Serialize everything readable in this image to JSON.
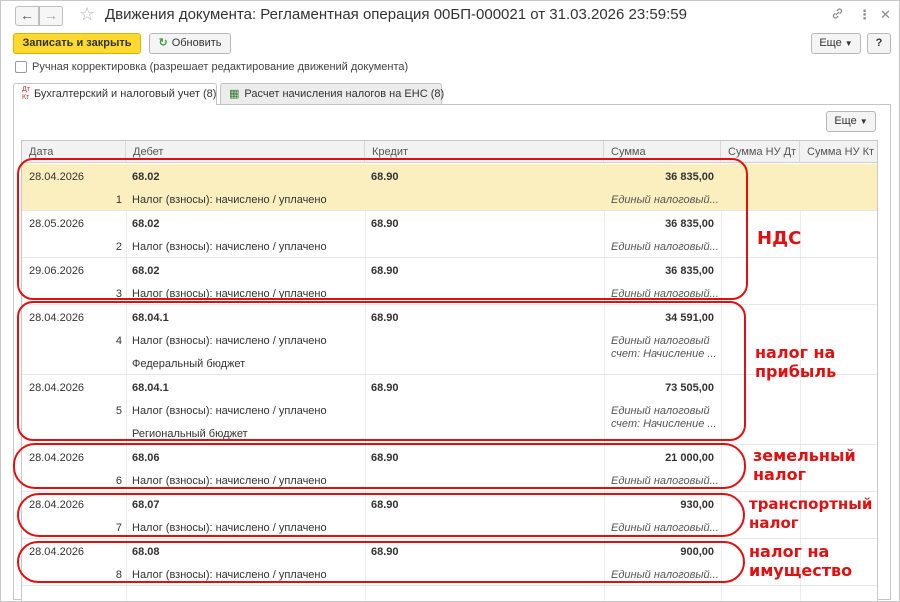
{
  "window": {
    "title": "Движения документа: Регламентная операция 00БП-000021 от 31.03.2026 23:59:59",
    "nav_back": "←",
    "nav_forward": "→"
  },
  "toolbar": {
    "save_close_label": "Записать и закрыть",
    "refresh_label": "Обновить",
    "more_label": "Еще",
    "help_label": "?"
  },
  "manual_adjust": {
    "label": "Ручная корректировка (разрешает редактирование движений документа)",
    "checked": false
  },
  "tabs": [
    {
      "label": "Бухгалтерский и налоговый учет (8)",
      "active": true
    },
    {
      "label": "Расчет начисления налогов на ЕНС (8)",
      "active": false
    }
  ],
  "table": {
    "more_label": "Еще",
    "columns": [
      "Дата",
      "Дебет",
      "Кредит",
      "Сумма",
      "Сумма НУ Дт",
      "Сумма НУ Кт"
    ],
    "rows": [
      {
        "date": "28.04.2026",
        "num": "1",
        "debit": "68.02",
        "debit_sub": "Налог (взносы): начислено / уплачено",
        "credit": "68.90",
        "sum": "36 835,00",
        "sum_note": "Единый налоговый...",
        "selected": true
      },
      {
        "date": "28.05.2026",
        "num": "2",
        "debit": "68.02",
        "debit_sub": "Налог (взносы): начислено / уплачено",
        "credit": "68.90",
        "sum": "36 835,00",
        "sum_note": "Единый налоговый..."
      },
      {
        "date": "29.06.2026",
        "num": "3",
        "debit": "68.02",
        "debit_sub": "Налог (взносы): начислено / уплачено",
        "credit": "68.90",
        "sum": "36 835,00",
        "sum_note": "Единый налоговый..."
      },
      {
        "date": "28.04.2026",
        "num": "4",
        "debit": "68.04.1",
        "debit_sub": "Налог (взносы): начислено / уплачено",
        "debit_sub2": "Федеральный бюджет",
        "credit": "68.90",
        "sum": "34 591,00",
        "sum_note": "Единый налоговый",
        "sum_note2": "счет: Начисление ..."
      },
      {
        "date": "28.04.2026",
        "num": "5",
        "debit": "68.04.1",
        "debit_sub": "Налог (взносы): начислено / уплачено",
        "debit_sub2": "Региональный бюджет",
        "credit": "68.90",
        "sum": "73 505,00",
        "sum_note": "Единый налоговый",
        "sum_note2": "счет: Начисление ..."
      },
      {
        "date": "28.04.2026",
        "num": "6",
        "debit": "68.06",
        "debit_sub": "Налог (взносы): начислено / уплачено",
        "credit": "68.90",
        "sum": "21 000,00",
        "sum_note": "Единый налоговый..."
      },
      {
        "date": "28.04.2026",
        "num": "7",
        "debit": "68.07",
        "debit_sub": "Налог (взносы): начислено / уплачено",
        "credit": "68.90",
        "sum": "930,00",
        "sum_note": "Единый налоговый..."
      },
      {
        "date": "28.04.2026",
        "num": "8",
        "debit": "68.08",
        "debit_sub": "Налог (взносы): начислено / уплачено",
        "credit": "68.90",
        "sum": "900,00",
        "sum_note": "Единый налоговый..."
      }
    ]
  },
  "annotations": {
    "nds": "НДС",
    "profit": "налог на\nприбыль",
    "land": "земельный\nналог",
    "transport": "транспортный\nналог",
    "property": "налог на\nимущество"
  },
  "colors": {
    "primary_button": "#ffd92f",
    "selected_row": "#fbefbf",
    "annotation_red": "#e01010"
  }
}
